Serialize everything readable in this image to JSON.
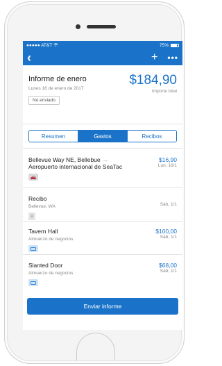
{
  "status_bar": {
    "carrier": "●●●●● AT&T",
    "wifi_icon": "wifi-icon",
    "battery_percent": "75%",
    "battery_level": 0.75
  },
  "nav": {
    "back_icon": "chevron-left-icon",
    "add_icon": "plus-icon",
    "more_icon": "more-icon",
    "back_glyph": "‹",
    "add_glyph": "+",
    "more_glyph": "•••"
  },
  "report": {
    "title": "Informe de enero",
    "date": "Lunes 16 de enero de 2017",
    "amount": "$184,90",
    "amount_label": "Importe total",
    "status": "No enviado"
  },
  "tabs": [
    {
      "label": "Resumen",
      "active": false
    },
    {
      "label": "Gastos",
      "active": true
    },
    {
      "label": "Recibos",
      "active": false
    }
  ],
  "expenses": [
    {
      "title": "Bellevue Way NE, Bellebue",
      "arrow": "→",
      "title2": "Aeropuerto internacional de SeaTac",
      "amount": "$16,90",
      "date": "Lun, 16/1",
      "icon": "car-icon"
    },
    {
      "title": "Recibo",
      "subtitle": "Bellevue, WA",
      "amount": "",
      "date": "Sáb, 1/1",
      "icon": "receipt-icon"
    },
    {
      "title": "Tavern Hall",
      "subtitle": "Almuerzo de negocios",
      "amount": "$100,00",
      "date": "Sáb, 1/1",
      "icon": "credit-card-icon"
    },
    {
      "title": "Slanted Door",
      "subtitle": "Almuerzo de negocios",
      "amount": "$68,00",
      "date": "Sáb, 1/1",
      "icon": "credit-card-icon"
    }
  ],
  "submit_label": "Enviar informe",
  "colors": {
    "primary": "#1a73c8",
    "text": "#222222",
    "muted": "#888888"
  }
}
